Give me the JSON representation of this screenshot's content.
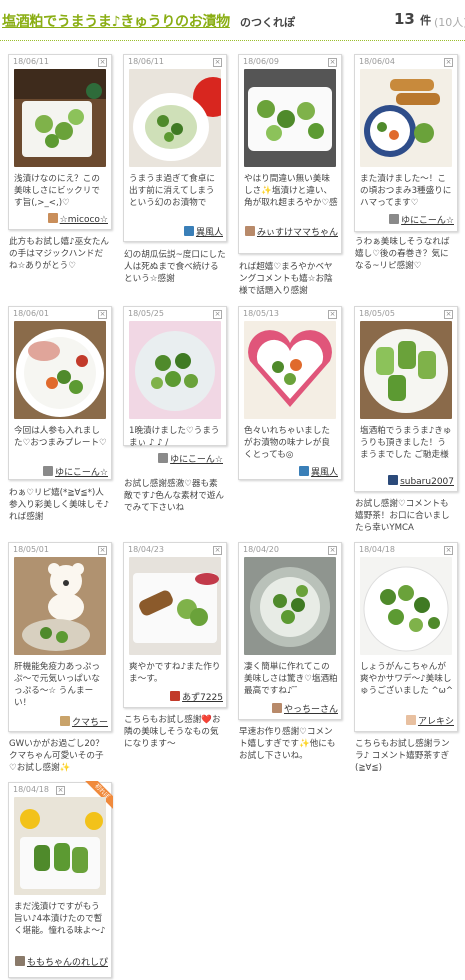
{
  "header": {
    "title": "塩酒粕でうまうま♪きゅうりのお漬物",
    "suffix": "のつくれぽ",
    "count": "13",
    "count_unit": "件",
    "total": "(10人)"
  },
  "reports": [
    {
      "date": "18/06/11",
      "caption": "浅漬けなのにえ？この美味しさにビックリです旨(,>_<,)♡",
      "user": "☆micoco☆",
      "reply": "此方もお試し嬉♪巫女たんの手はマジックハンドだね☆ありがとう♡"
    },
    {
      "date": "18/06/11",
      "caption": "うまうま過ぎて食卓に出す前に消えてしまうという幻のお漬物です…",
      "user": "異風人",
      "reply": "幻の胡瓜伝説~度口にした人は死ぬまで食べ続けるという☆感謝"
    },
    {
      "date": "18/06/09",
      "caption": "やはり間違い無い美味しさ✨塩漬けと違い、角が取れ超まろやか♡感謝",
      "user": "みぃすけママちゃん",
      "reply": "れば超嬉♡まろやかベヤングコメントも嬉☆お陰様で話題入り感謝"
    },
    {
      "date": "18/06/04",
      "caption": "また漬けました〜！この頃おつまみ3種盛りにハマってます♡",
      "user": "ゆにこーん☆",
      "reply": "うわぁ美味しそうなれば嬉し♡後の春巻き？気になる~リピ感謝♡"
    },
    {
      "date": "18/06/01",
      "caption": "今回は人参も入れました♡おつまみプレート♡",
      "user": "ゆにこーん☆",
      "reply": "わぁ♡リピ嬉(*≧∀≦*)人参入り彩美しく美味しそ♪れば感謝"
    },
    {
      "date": "18/05/25",
      "caption": "1晩漬けました♡うまうまぃ ♪ ♪ /",
      "user": "ゆにこーん☆",
      "reply": "お試し感謝感激♡器も素敵です♪色んな素材で遊んでみて下さいね"
    },
    {
      "date": "18/05/13",
      "caption": "色々いれちゃいましたがお漬物の味ナレが良くとっても◎",
      "user": "異風人",
      "reply": ""
    },
    {
      "date": "18/05/05",
      "caption": "塩酒粕でうまうま♪きゅうりも頂きました！うまうまでした ご馳走様♪",
      "user": "subaru2007",
      "reply": "お試し感謝♡コメントも嬉野茶！お口に合いましたら幸いYMCA"
    },
    {
      "date": "18/05/01",
      "caption": "肝機能免疫力あっぷっぷ〜で元気いっぱいなっぷる〜☆ うんまーい！",
      "user": "クマちー",
      "reply": "GWいかがお過ごし20？クマちゃん可愛いその子♡お試し感謝✨"
    },
    {
      "date": "18/04/23",
      "caption": "爽やかですね♪また作りま〜す。",
      "user": "あず7225",
      "reply": "こちらもお試し感謝❤️お隣の美味しそうなもの気になります〜"
    },
    {
      "date": "18/04/20",
      "caption": "凄く簡単に作れてこの美味しさは驚き♡塩酒粕最高ですね♪ ̄ ̄",
      "user": "やっちーさん",
      "reply": "早速お作り感謝♡コメント嬉しすぎです✨他にもお試し下さいね。"
    },
    {
      "date": "18/04/18",
      "caption": "しょうがんこちゃんが爽やかサワデ〜♪美味しゅうございました ^ω^",
      "user": "アレキシ",
      "reply": "こちらもお試し感謝ランラ♪ コメント嬉野茶すぎ(≧∀≦)"
    },
    {
      "date": "18/04/18",
      "caption": "まだ浅漬けですがもう旨い♪4本漬けたので暫く堪能。憧れる味よ〜♪",
      "user": "ももちゃんのれしぴ",
      "reply": "",
      "badge": "初れぽ"
    }
  ],
  "colors": {
    "accent": "#8aae14",
    "badge": "#f08a3c",
    "cucumber": "#4f8a2b"
  }
}
